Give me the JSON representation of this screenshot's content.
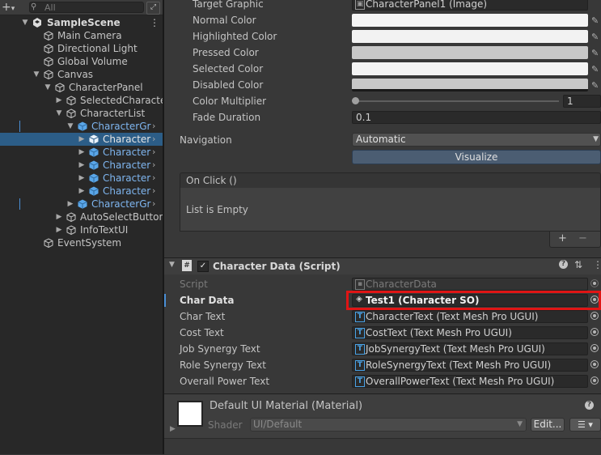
{
  "hierarchy": {
    "search_placeholder": "All",
    "add_label": "+",
    "rows": [
      {
        "label": "SampleScene"
      },
      {
        "label": "Main Camera"
      },
      {
        "label": "Directional Light"
      },
      {
        "label": "Global Volume"
      },
      {
        "label": "Canvas"
      },
      {
        "label": "CharacterPanel"
      },
      {
        "label": "SelectedCharacte"
      },
      {
        "label": "CharacterList"
      },
      {
        "label": "CharacterGr"
      },
      {
        "label": "Character"
      },
      {
        "label": "Character"
      },
      {
        "label": "Character"
      },
      {
        "label": "Character"
      },
      {
        "label": "Character"
      },
      {
        "label": "CharacterGr"
      },
      {
        "label": "AutoSelectButton"
      },
      {
        "label": "InfoTextUI"
      },
      {
        "label": "EventSystem"
      }
    ]
  },
  "button_component": {
    "target_graphic_label": "Target Graphic",
    "target_graphic_value": "CharacterPanel1 (Image)",
    "normal_color_label": "Normal Color",
    "highlighted_color_label": "Highlighted Color",
    "pressed_color_label": "Pressed Color",
    "selected_color_label": "Selected Color",
    "disabled_color_label": "Disabled Color",
    "color_multiplier_label": "Color Multiplier",
    "color_multiplier_value": "1",
    "fade_duration_label": "Fade Duration",
    "fade_duration_value": "0.1",
    "navigation_label": "Navigation",
    "navigation_value": "Automatic",
    "visualize_label": "Visualize",
    "on_click_label": "On Click ()",
    "list_empty_label": "List is Empty",
    "add_label": "+",
    "remove_label": "−"
  },
  "character_data": {
    "header_title": "Character Data (Script)",
    "script_label": "Script",
    "script_value": "CharacterData",
    "char_data_label": "Char Data",
    "char_data_value": "Test1 (Character SO)",
    "char_text_label": "Char Text",
    "char_text_value": "CharacterText (Text Mesh Pro UGUI)",
    "cost_text_label": "Cost Text",
    "cost_text_value": "CostText (Text Mesh Pro UGUI)",
    "job_text_label": "Job Synergy Text",
    "job_text_value": "JobSynergyText (Text Mesh Pro UGUI)",
    "role_text_label": "Role Synergy Text",
    "role_text_value": "RoleSynergyText (Text Mesh Pro UGUI)",
    "power_text_label": "Overall Power Text",
    "power_text_value": "OverallPowerText (Text Mesh Pro UGUI)"
  },
  "material": {
    "title": "Default UI Material (Material)",
    "shader_label": "Shader",
    "shader_value": "UI/Default",
    "edit_label": "Edit...",
    "list_icon": "list-icon"
  },
  "colors": {
    "selection": "#2c5d87",
    "highlight_box": "#e01515",
    "blue_prefab": "#7fb6f0"
  }
}
